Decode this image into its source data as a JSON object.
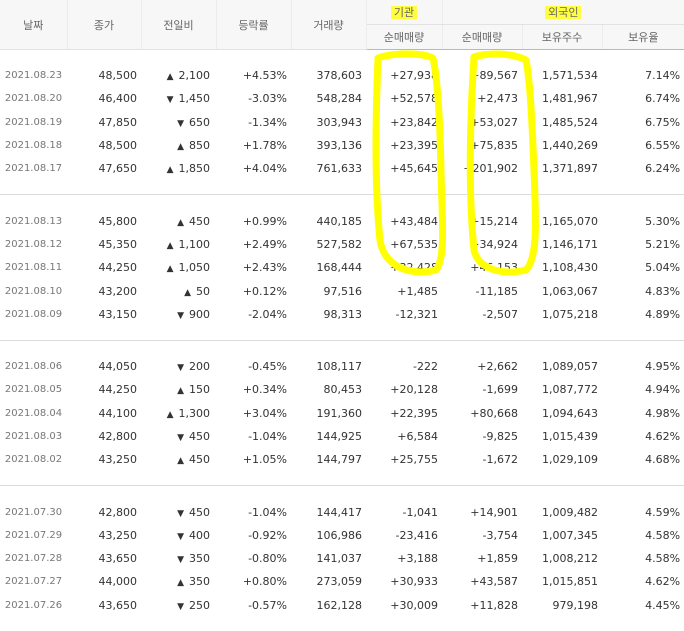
{
  "headers": {
    "date": "날짜",
    "close": "종가",
    "change": "전일비",
    "rate": "등락률",
    "volume": "거래량",
    "institution": "기관",
    "foreign": "외국인",
    "inst_net": "순매매량",
    "foreign_net": "순매매량",
    "holdings": "보유주수",
    "holding_ratio": "보유율"
  },
  "annotation": {
    "color": "#ffff00",
    "highlighted_columns": [
      "institution_net",
      "foreign_net"
    ]
  },
  "groups": [
    [
      {
        "date": "2021.08.23",
        "close": "48,500",
        "dir": "up",
        "change": "2,100",
        "rate": "+4.53%",
        "volume": "378,603",
        "inst": "+27,938",
        "foreign": "+89,567",
        "holdings": "1,571,534",
        "ratio": "7.14%"
      },
      {
        "date": "2021.08.20",
        "close": "46,400",
        "dir": "down",
        "change": "1,450",
        "rate": "-3.03%",
        "volume": "548,284",
        "inst": "+52,578",
        "foreign": "+2,473",
        "holdings": "1,481,967",
        "ratio": "6.74%"
      },
      {
        "date": "2021.08.19",
        "close": "47,850",
        "dir": "down",
        "change": "650",
        "rate": "-1.34%",
        "volume": "303,943",
        "inst": "+23,842",
        "foreign": "+53,027",
        "holdings": "1,485,524",
        "ratio": "6.75%"
      },
      {
        "date": "2021.08.18",
        "close": "48,500",
        "dir": "up",
        "change": "850",
        "rate": "+1.78%",
        "volume": "393,136",
        "inst": "+23,395",
        "foreign": "+75,835",
        "holdings": "1,440,269",
        "ratio": "6.55%"
      },
      {
        "date": "2021.08.17",
        "close": "47,650",
        "dir": "up",
        "change": "1,850",
        "rate": "+4.04%",
        "volume": "761,633",
        "inst": "+45,645",
        "foreign": "+201,902",
        "holdings": "1,371,897",
        "ratio": "6.24%"
      }
    ],
    [
      {
        "date": "2021.08.13",
        "close": "45,800",
        "dir": "up",
        "change": "450",
        "rate": "+0.99%",
        "volume": "440,185",
        "inst": "+43,484",
        "foreign": "+15,214",
        "holdings": "1,165,070",
        "ratio": "5.30%"
      },
      {
        "date": "2021.08.12",
        "close": "45,350",
        "dir": "up",
        "change": "1,100",
        "rate": "+2.49%",
        "volume": "527,582",
        "inst": "+67,535",
        "foreign": "+34,924",
        "holdings": "1,146,171",
        "ratio": "5.21%"
      },
      {
        "date": "2021.08.11",
        "close": "44,250",
        "dir": "up",
        "change": "1,050",
        "rate": "+2.43%",
        "volume": "168,444",
        "inst": "+32,428",
        "foreign": "+46,153",
        "holdings": "1,108,430",
        "ratio": "5.04%"
      },
      {
        "date": "2021.08.10",
        "close": "43,200",
        "dir": "up",
        "change": "50",
        "rate": "+0.12%",
        "volume": "97,516",
        "inst": "+1,485",
        "foreign": "-11,185",
        "holdings": "1,063,067",
        "ratio": "4.83%"
      },
      {
        "date": "2021.08.09",
        "close": "43,150",
        "dir": "down",
        "change": "900",
        "rate": "-2.04%",
        "volume": "98,313",
        "inst": "-12,321",
        "foreign": "-2,507",
        "holdings": "1,075,218",
        "ratio": "4.89%"
      }
    ],
    [
      {
        "date": "2021.08.06",
        "close": "44,050",
        "dir": "down",
        "change": "200",
        "rate": "-0.45%",
        "volume": "108,117",
        "inst": "-222",
        "foreign": "+2,662",
        "holdings": "1,089,057",
        "ratio": "4.95%"
      },
      {
        "date": "2021.08.05",
        "close": "44,250",
        "dir": "up",
        "change": "150",
        "rate": "+0.34%",
        "volume": "80,453",
        "inst": "+20,128",
        "foreign": "-1,699",
        "holdings": "1,087,772",
        "ratio": "4.94%"
      },
      {
        "date": "2021.08.04",
        "close": "44,100",
        "dir": "up",
        "change": "1,300",
        "rate": "+3.04%",
        "volume": "191,360",
        "inst": "+22,395",
        "foreign": "+80,668",
        "holdings": "1,094,643",
        "ratio": "4.98%"
      },
      {
        "date": "2021.08.03",
        "close": "42,800",
        "dir": "down",
        "change": "450",
        "rate": "-1.04%",
        "volume": "144,925",
        "inst": "+6,584",
        "foreign": "-9,825",
        "holdings": "1,015,439",
        "ratio": "4.62%"
      },
      {
        "date": "2021.08.02",
        "close": "43,250",
        "dir": "up",
        "change": "450",
        "rate": "+1.05%",
        "volume": "144,797",
        "inst": "+25,755",
        "foreign": "-1,672",
        "holdings": "1,029,109",
        "ratio": "4.68%"
      }
    ],
    [
      {
        "date": "2021.07.30",
        "close": "42,800",
        "dir": "down",
        "change": "450",
        "rate": "-1.04%",
        "volume": "144,417",
        "inst": "-1,041",
        "foreign": "+14,901",
        "holdings": "1,009,482",
        "ratio": "4.59%"
      },
      {
        "date": "2021.07.29",
        "close": "43,250",
        "dir": "down",
        "change": "400",
        "rate": "-0.92%",
        "volume": "106,986",
        "inst": "-23,416",
        "foreign": "-3,754",
        "holdings": "1,007,345",
        "ratio": "4.58%"
      },
      {
        "date": "2021.07.28",
        "close": "43,650",
        "dir": "down",
        "change": "350",
        "rate": "-0.80%",
        "volume": "141,037",
        "inst": "+3,188",
        "foreign": "+1,859",
        "holdings": "1,008,212",
        "ratio": "4.58%"
      },
      {
        "date": "2021.07.27",
        "close": "44,000",
        "dir": "up",
        "change": "350",
        "rate": "+0.80%",
        "volume": "273,059",
        "inst": "+30,933",
        "foreign": "+43,587",
        "holdings": "1,015,851",
        "ratio": "4.62%"
      },
      {
        "date": "2021.07.26",
        "close": "43,650",
        "dir": "down",
        "change": "250",
        "rate": "-0.57%",
        "volume": "162,128",
        "inst": "+30,009",
        "foreign": "+11,828",
        "holdings": "979,198",
        "ratio": "4.45%"
      }
    ]
  ]
}
